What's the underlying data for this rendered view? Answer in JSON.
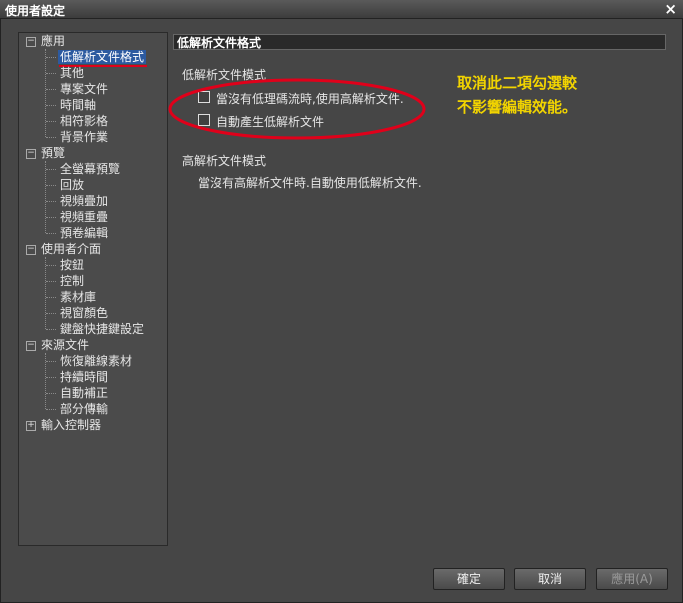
{
  "window": {
    "title": "使用者設定",
    "close_symbol": "×"
  },
  "tree": {
    "groups": [
      {
        "label": "應用",
        "toggle": "−",
        "items": [
          "低解析文件格式",
          "其他",
          "專案文件",
          "時間軸",
          "相符影格",
          "背景作業"
        ]
      },
      {
        "label": "預覽",
        "toggle": "−",
        "items": [
          "全螢幕預覽",
          "回放",
          "視頻疊加",
          "視頻重疊",
          "預卷編輯"
        ]
      },
      {
        "label": "使用者介面",
        "toggle": "−",
        "items": [
          "按鈕",
          "控制",
          "素材庫",
          "視窗顏色",
          "鍵盤快捷鍵設定"
        ]
      },
      {
        "label": "來源文件",
        "toggle": "−",
        "items": [
          "恢復離線素材",
          "持續時間",
          "自動補正",
          "部分傳輸"
        ]
      },
      {
        "label": "輸入控制器",
        "toggle": "+",
        "items": []
      }
    ],
    "selected_item": "低解析文件格式"
  },
  "panel": {
    "title": "低解析文件格式",
    "low_res_section": {
      "heading": "低解析文件模式",
      "options": [
        {
          "label": "當沒有低理碼流時,使用高解析文件.",
          "checked": false
        },
        {
          "label": "自動產生低解析文件",
          "checked": false
        }
      ]
    },
    "high_res_section": {
      "heading": "高解析文件模式",
      "text": "當沒有高解析文件時.自動使用低解析文件."
    }
  },
  "annotation": {
    "line1": "取消此二項勾選較",
    "line2": "不影響編輯效能。",
    "ellipse_color": "#e0001a",
    "text_color": "#f2d400"
  },
  "buttons": {
    "ok": "確定",
    "cancel": "取消",
    "apply": "應用(A)"
  }
}
